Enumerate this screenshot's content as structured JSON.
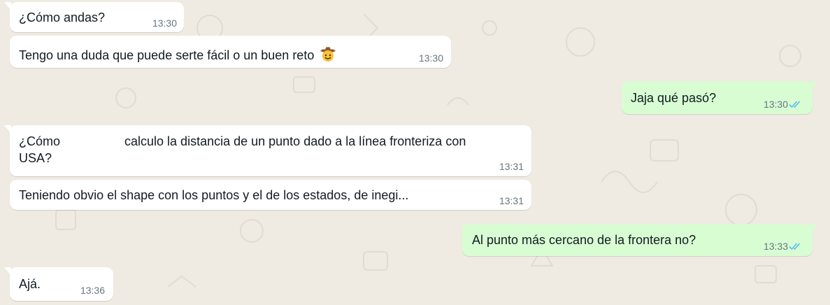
{
  "chat": {
    "messages": [
      {
        "direction": "in",
        "text": "¿Cómo andas?",
        "time": "13:30"
      },
      {
        "direction": "in",
        "text": "Tengo una duda que puede serte fácil o un buen reto",
        "emoji": "cowboy-face-icon",
        "time": "13:30"
      },
      {
        "direction": "out",
        "text": "Jaja qué pasó?",
        "time": "13:30",
        "status": "read"
      },
      {
        "direction": "in",
        "text_before": "¿Cómo",
        "text_after": "calculo la distancia de un punto dado a la línea fronteriza con",
        "text_line2": "USA?",
        "time": "13:31"
      },
      {
        "direction": "in",
        "text": "Teniendo obvio el shape con los puntos y el de los estados, de inegi...",
        "time": "13:31"
      },
      {
        "direction": "out",
        "text": "Al punto más cercano de la frontera no?",
        "time": "13:33",
        "status": "read"
      },
      {
        "direction": "in",
        "text": "Ajá.",
        "time": "13:36"
      }
    ]
  },
  "colors": {
    "background": "#efeae2",
    "incoming_bubble": "#ffffff",
    "outgoing_bubble": "#d9fdd3",
    "read_ticks": "#53bdeb",
    "timestamp": "#667781",
    "text": "#111b21"
  }
}
